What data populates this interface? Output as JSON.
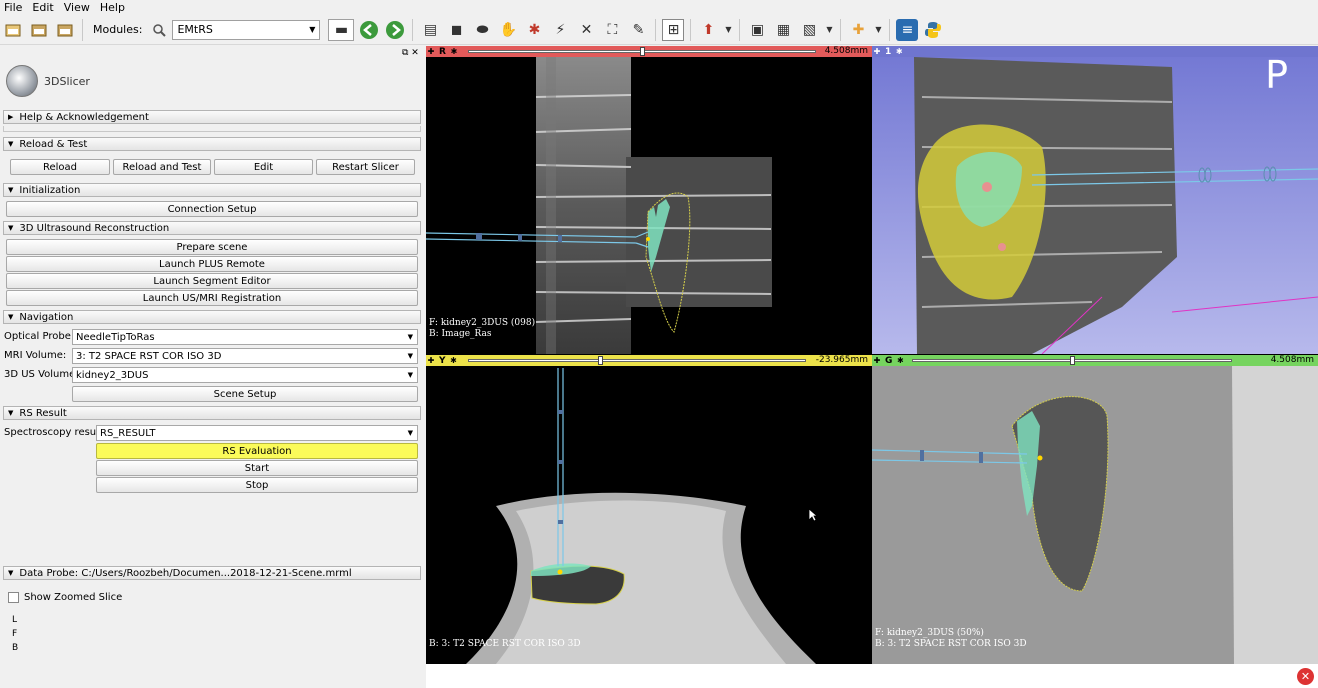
{
  "menu": [
    "File",
    "Edit",
    "View",
    "Help"
  ],
  "toolbar": {
    "modules_label": "Modules:",
    "module_selected": "EMtRS",
    "icons": [
      "data-icon",
      "dcm-icon",
      "save-icon",
      "search-icon",
      "back-icon",
      "forward-icon",
      "layout-icon",
      "python-icon"
    ]
  },
  "logo_text": "3DSlicer",
  "sections": {
    "help": "Help & Acknowledgement",
    "reload_test": "Reload & Test",
    "initialization": "Initialization",
    "reconstruction": "3D Ultrasound Reconstruction",
    "navigation": "Navigation",
    "rs_result": "RS Result",
    "data_probe": "Data Probe: C:/Users/Roozbeh/Documen...2018-12-21-Scene.mrml"
  },
  "reload_buttons": {
    "reload": "Reload",
    "reload_test": "Reload and Test",
    "edit": "Edit",
    "restart": "Restart Slicer"
  },
  "init_buttons": {
    "connection_setup": "Connection Setup"
  },
  "recon_buttons": {
    "prepare_scene": "Prepare scene",
    "launch_plus": "Launch PLUS Remote",
    "launch_segment": "Launch Segment Editor",
    "launch_registration": "Launch US/MRI Registration"
  },
  "navigation": {
    "optical_probe_label": "Optical Probe:",
    "optical_probe_value": "NeedleTipToRas",
    "mri_volume_label": "MRI Volume:",
    "mri_volume_value": "3: T2 SPACE RST COR ISO 3D",
    "us_volume_label": "3D US Volume:",
    "us_volume_value": "kidney2_3DUS",
    "scene_setup": "Scene Setup"
  },
  "rs": {
    "spectroscopy_label": "Spectroscopy result:",
    "spectroscopy_value": "RS_RESULT",
    "evaluation": "RS Evaluation",
    "start": "Start",
    "stop": "Stop"
  },
  "data_probe": {
    "show_zoomed": "Show Zoomed Slice",
    "letters": [
      "L",
      "F",
      "B"
    ]
  },
  "views": {
    "red": {
      "label": "R",
      "value": "4.508mm",
      "slider_frac": 0.5,
      "color": "#e25a5a",
      "fg": "F: kidney2_3DUS (098)",
      "bg": "B: Image_Ras"
    },
    "threeD": {
      "label": "1",
      "color": "#6f75cf",
      "orient": "P"
    },
    "yellow": {
      "label": "Y",
      "value": "-23.965mm",
      "slider_frac": 0.39,
      "color": "#ece24a",
      "bg": "B: 3: T2 SPACE RST COR ISO 3D"
    },
    "green": {
      "label": "G",
      "value": "4.508mm",
      "slider_frac": 0.5,
      "color": "#76d45f",
      "fg": "F: kidney2_3DUS (50%)",
      "bg": "B: 3: T2 SPACE RST COR ISO 3D"
    }
  },
  "colors": {
    "rs_evaluation": "#fbfb5a",
    "segment_fill": "#7fe3c0",
    "contour": "#d6d04a"
  }
}
